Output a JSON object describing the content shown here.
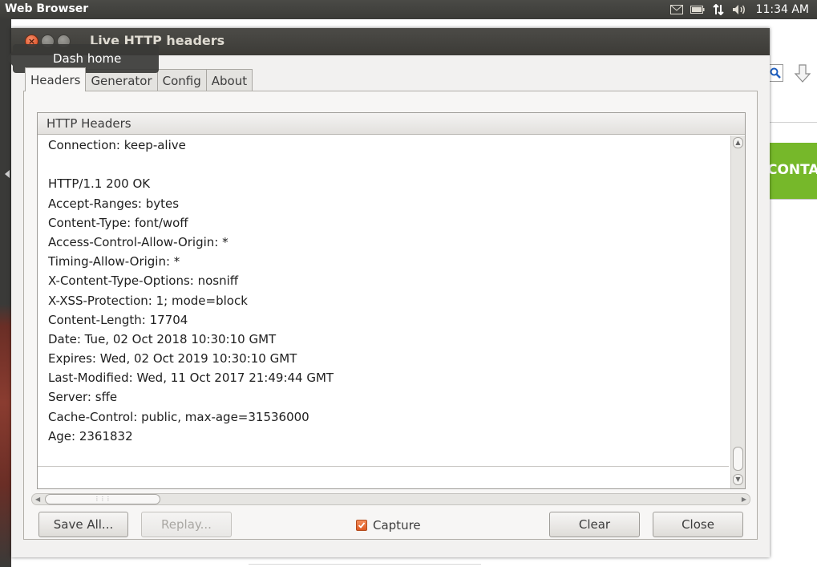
{
  "top_panel": {
    "app_title": "Web Browser",
    "clock": "11:34 AM",
    "tray_icons": [
      "mail-icon",
      "battery-icon",
      "network-icon",
      "volume-icon"
    ]
  },
  "background_browser": {
    "banner_text": "CONTA"
  },
  "tooltip": {
    "text": "Dash home"
  },
  "window": {
    "title": "Live HTTP headers",
    "close_glyph": "×"
  },
  "tabs": [
    {
      "label": "Headers",
      "active": true
    },
    {
      "label": "Generator",
      "active": false
    },
    {
      "label": "Config",
      "active": false
    },
    {
      "label": "About",
      "active": false
    }
  ],
  "headers_panel": {
    "column_header": "HTTP Headers",
    "lines": [
      "Connection: keep-alive",
      "",
      "HTTP/1.1 200 OK",
      "Accept-Ranges: bytes",
      "Content-Type: font/woff",
      "Access-Control-Allow-Origin: *",
      "Timing-Allow-Origin: *",
      "X-Content-Type-Options: nosniff",
      "X-XSS-Protection: 1; mode=block",
      "Content-Length: 17704",
      "Date: Tue, 02 Oct 2018 10:30:10 GMT",
      "Expires: Wed, 02 Oct 2019 10:30:10 GMT",
      "Last-Modified: Wed, 11 Oct 2017 21:49:44 GMT",
      "Server: sffe",
      "Cache-Control: public, max-age=31536000",
      "Age: 2361832"
    ]
  },
  "buttons": {
    "save_all": "Save All...",
    "replay": "Replay...",
    "clear": "Clear",
    "close": "Close"
  },
  "capture": {
    "label": "Capture",
    "checked": true
  },
  "colors": {
    "accent_orange": "#dd5a23",
    "banner_green": "#76b82a",
    "titlebar": "#3c3b37"
  }
}
